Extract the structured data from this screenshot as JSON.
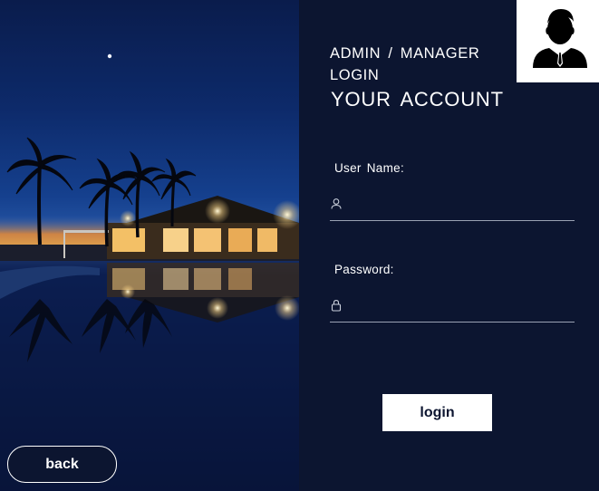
{
  "header": {
    "subtitle": "ADMIN  /  MANAGER LOGIN",
    "title": "YOUR  ACCOUNT"
  },
  "form": {
    "username_label": "User  Name:",
    "username_value": "",
    "password_label": "Password:",
    "password_value": "",
    "username_icon": "user-icon",
    "password_icon": "lock-icon"
  },
  "buttons": {
    "login": "login",
    "back": "back"
  },
  "avatar": {
    "icon": "businessman-avatar-icon"
  },
  "colors": {
    "panel_bg": "#0c1530",
    "text": "#ffffff",
    "button_bg": "#ffffff",
    "underline": "#9aa2b3"
  }
}
